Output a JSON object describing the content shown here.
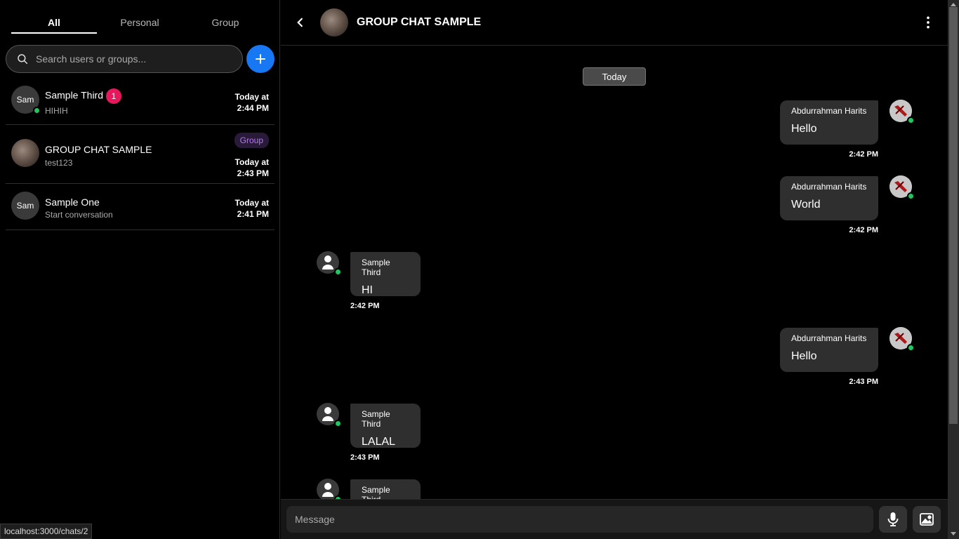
{
  "sidebar": {
    "tabs": [
      {
        "label": "All"
      },
      {
        "label": "Personal"
      },
      {
        "label": "Group"
      }
    ],
    "search": {
      "placeholder": "Search users or groups..."
    },
    "chats": [
      {
        "avatar_text": "Sam",
        "name": "Sample Third",
        "preview": "HIHIH",
        "time_line1": "Today at",
        "time_line2": "2:44 PM",
        "unread": "1"
      },
      {
        "avatar_text": "",
        "name": "GROUP CHAT SAMPLE",
        "preview": "test123",
        "time_line1": "Today at",
        "time_line2": "2:43 PM",
        "tag": "Group"
      },
      {
        "avatar_text": "Sam",
        "name": "Sample One",
        "preview": "Start conversation",
        "time_line1": "Today at",
        "time_line2": "2:41 PM"
      }
    ]
  },
  "status_url": "localhost:3000/chats/2",
  "header": {
    "title": "GROUP CHAT SAMPLE"
  },
  "messages": {
    "day_label": "Today",
    "items": [
      {
        "sender": "Abdurrahman Harits",
        "text": "Hello",
        "time": "2:42 PM"
      },
      {
        "sender": "Abdurrahman Harits",
        "text": "World",
        "time": "2:42 PM"
      },
      {
        "sender": "Sample Third",
        "text": "HI",
        "time": "2:42 PM"
      },
      {
        "sender": "Abdurrahman Harits",
        "text": "Hello",
        "time": "2:43 PM"
      },
      {
        "sender": "Sample Third",
        "text": "LALAL",
        "time": "2:43 PM"
      },
      {
        "sender": "Sample Third",
        "text": "",
        "time": ""
      }
    ]
  },
  "composer": {
    "placeholder": "Message"
  },
  "colors": {
    "accent": "#1877f2",
    "online": "#22c55e",
    "unread": "#e8175d",
    "group_tag": "#b07ae8"
  }
}
